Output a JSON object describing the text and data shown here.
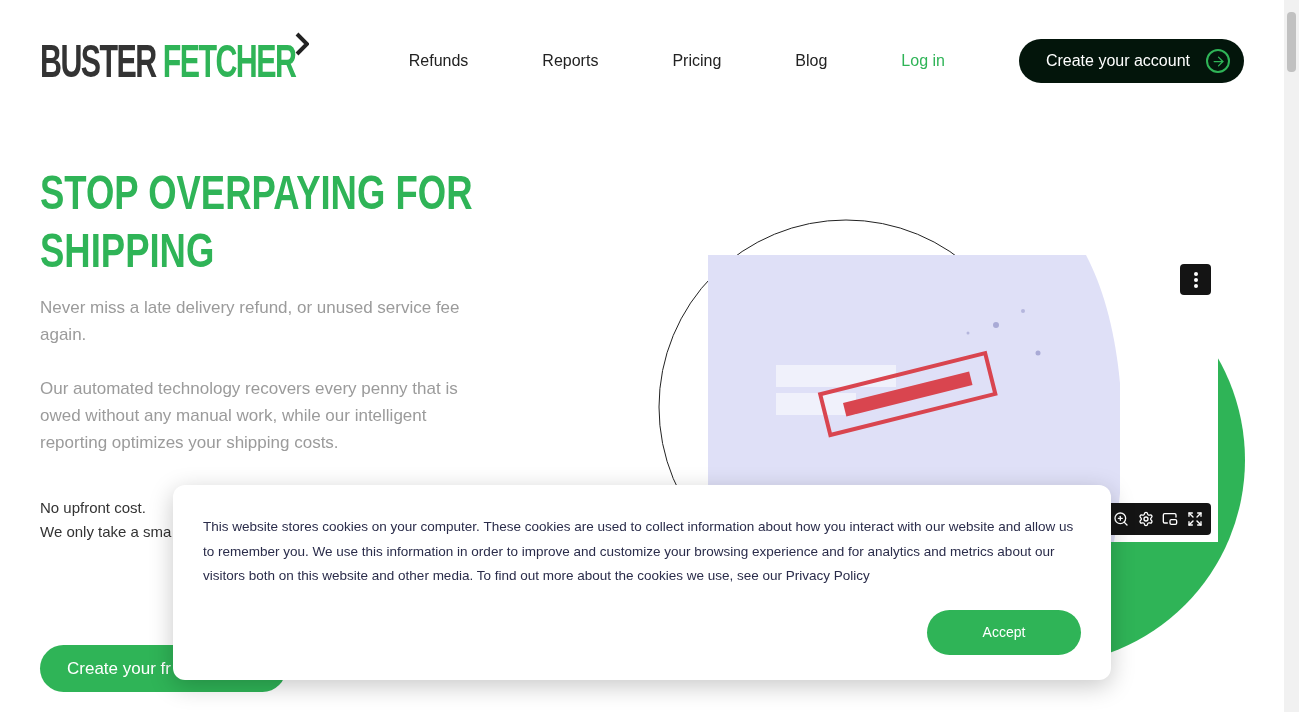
{
  "logo": {
    "part_1": "BUSTER",
    "part_2": "FETCHER"
  },
  "nav": [
    {
      "label": "Refunds",
      "kind": "link"
    },
    {
      "label": "Reports",
      "kind": "link"
    },
    {
      "label": "Pricing",
      "kind": "link"
    },
    {
      "label": "Blog",
      "kind": "link"
    },
    {
      "label": "Log in",
      "kind": "accent"
    }
  ],
  "header_cta": {
    "label": "Create your account"
  },
  "hero": {
    "title": "STOP OVERPAYING FOR SHIPPING",
    "paragraphs": [
      "Never miss a late delivery refund, or unused service fee again.",
      "Our automated technology recovers every penny that is owed without any manual work, while our intelligent reporting optimizes your shipping costs."
    ],
    "note_lines": [
      "No upfront cost.",
      "We only take a sma"
    ],
    "button": "Create your fr"
  },
  "cookie_banner": {
    "text": "This website stores cookies on your computer. These cookies are used to collect information about how you interact with our website and allow us to remember you. We use this information in order to improve and customize your browsing experience and for analytics and metrics about our visitors both on this website and other media. To find out more about the cookies we use, see our Privacy Policy",
    "accept": "Accept"
  }
}
